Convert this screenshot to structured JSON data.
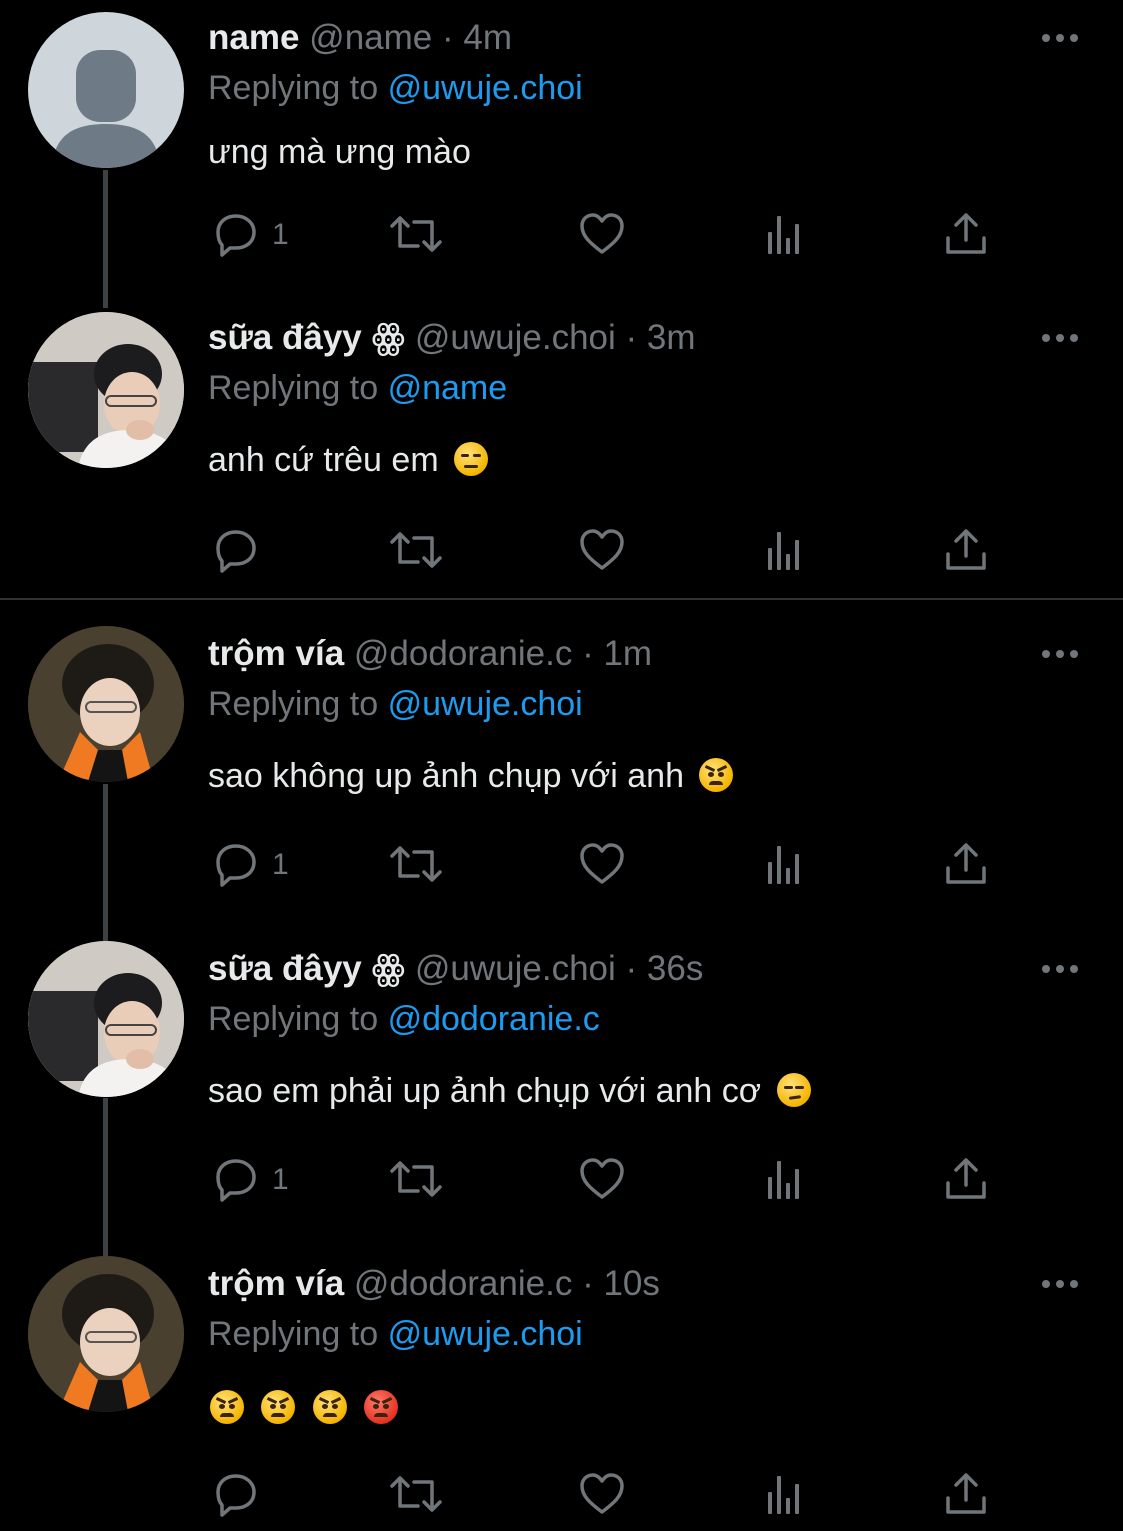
{
  "tweets": [
    {
      "display_name": "name",
      "handle": "@name",
      "time": "4m",
      "reply_prefix": "Replying to",
      "reply_to": "@uwuje.choi",
      "text": "ưng mà ưng mào",
      "reply_count": "1"
    },
    {
      "display_name": "sữa đâyy ꙮ",
      "handle": "@uwuje.choi",
      "time": "3m",
      "reply_prefix": "Replying to",
      "reply_to": "@name",
      "text": "anh cứ trêu em",
      "reply_count": ""
    },
    {
      "display_name": "trộm vía",
      "handle": "@dodoranie.c",
      "time": "1m",
      "reply_prefix": "Replying to",
      "reply_to": "@uwuje.choi",
      "text": "sao không up ảnh chụp với anh",
      "reply_count": "1"
    },
    {
      "display_name": "sữa đâyy ꙮ",
      "handle": "@uwuje.choi",
      "time": "36s",
      "reply_prefix": "Replying to",
      "reply_to": "@dodoranie.c",
      "text": "sao em phải up ảnh chụp với anh cơ",
      "reply_count": "1"
    },
    {
      "display_name": "trộm vía",
      "handle": "@dodoranie.c",
      "time": "10s",
      "reply_prefix": "Replying to",
      "reply_to": "@uwuje.choi",
      "text": "",
      "reply_count": ""
    }
  ],
  "separator": "·",
  "colors": {
    "background": "#000000",
    "text": "#e7e9ea",
    "muted": "#71767b",
    "link": "#1d9bf0",
    "thread_line": "#3e4144"
  }
}
